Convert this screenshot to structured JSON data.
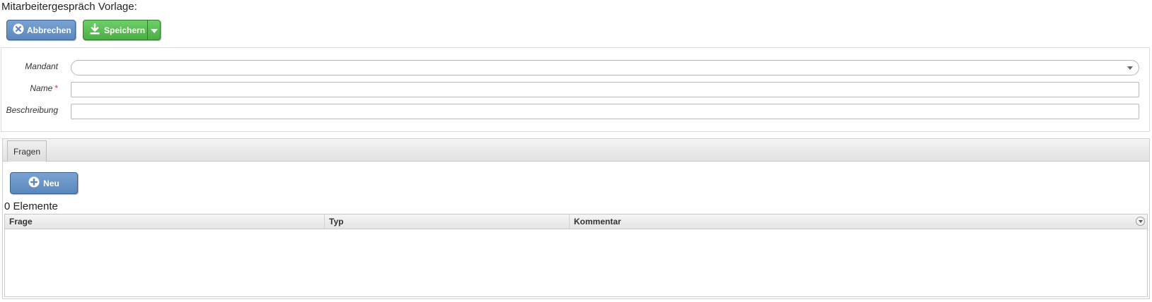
{
  "page": {
    "title": "Mitarbeitergespräch Vorlage:"
  },
  "toolbar": {
    "cancel_label": "Abbrechen",
    "save_label": "Speichern"
  },
  "form": {
    "mandant": {
      "label": "Mandant",
      "value": ""
    },
    "name": {
      "label": "Name",
      "required_marker": "*",
      "value": ""
    },
    "beschreibung": {
      "label": "Beschreibung",
      "value": ""
    }
  },
  "tabs": [
    {
      "label": "Fragen"
    }
  ],
  "questions": {
    "new_label": "Neu",
    "count_text": "0 Elemente",
    "columns": [
      "Frage",
      "Typ",
      "Kommentar"
    ],
    "rows": []
  },
  "colors": {
    "primary_blue": "#5b87bd",
    "success_green": "#4cae44",
    "required_red": "#c0392b"
  }
}
